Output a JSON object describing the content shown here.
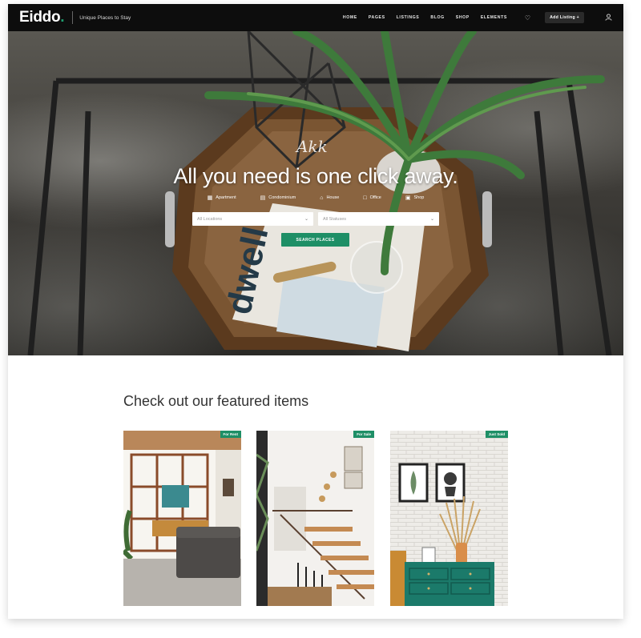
{
  "header": {
    "logo_text": "Eiddo",
    "logo_dot": ".",
    "tagline": "Unique Places to Stay",
    "menu": [
      "HOME",
      "PAGES",
      "LISTINGS",
      "BLOG",
      "SHOP",
      "ELEMENTS"
    ],
    "add_listing": "Add Listing +"
  },
  "hero": {
    "script": "Akk",
    "title": "All you need is one click away.",
    "categories": [
      "Apartment",
      "Condominium",
      "House",
      "Office",
      "Shop"
    ],
    "location_placeholder": "All Locations",
    "status_placeholder": "All Statuses",
    "search_button": "SEARCH PLACES"
  },
  "featured": {
    "title": "Check out our featured items",
    "items": [
      {
        "badge": "For Rent"
      },
      {
        "badge": "For Sale"
      },
      {
        "badge": "Just Sold"
      }
    ]
  },
  "colors": {
    "accent": "#1e8f66",
    "nav_bg": "#0d0d0d"
  }
}
